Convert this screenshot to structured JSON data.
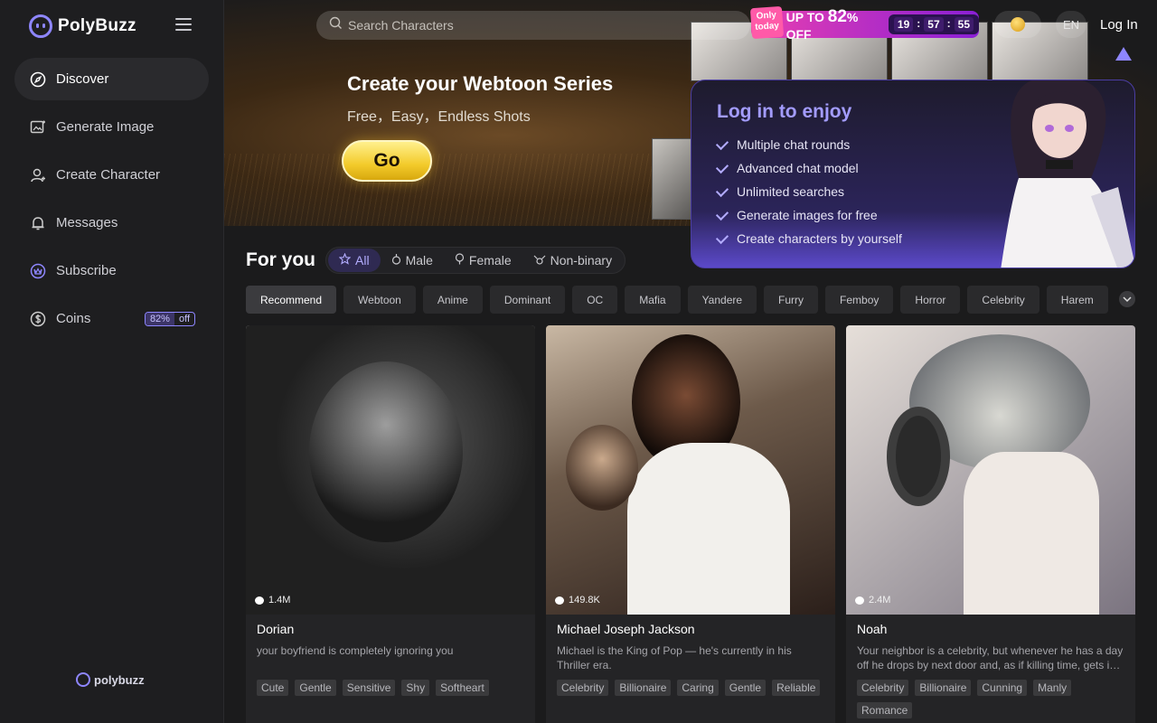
{
  "brand": {
    "name": "PolyBuzz",
    "footer_name": "polybuzz"
  },
  "sidebar": {
    "items": [
      {
        "label": "Discover",
        "icon": "compass-icon",
        "active": true
      },
      {
        "label": "Generate Image",
        "icon": "image-plus-icon"
      },
      {
        "label": "Create Character",
        "icon": "user-plus-icon"
      },
      {
        "label": "Messages",
        "icon": "bell-icon"
      },
      {
        "label": "Subscribe",
        "icon": "crown-icon"
      },
      {
        "label": "Coins",
        "icon": "dollar-icon",
        "badge_percent": "82%",
        "badge_off": "off"
      }
    ]
  },
  "header": {
    "search_placeholder": "Search Characters",
    "promo": {
      "tag_line1": "Only",
      "tag_line2": "today",
      "prefix": "UP TO",
      "percent": "82",
      "percent_sign": "%",
      "suffix": "OFF",
      "hours": "19",
      "minutes": "57",
      "seconds": "55"
    },
    "lang": "EN",
    "login": "Log In"
  },
  "hero": {
    "title": "Create your Webtoon Series",
    "subtitle": "Free，Easy，Endless Shots",
    "cta": "Go"
  },
  "login_card": {
    "title": "Log in to enjoy",
    "perks": [
      "Multiple chat rounds",
      "Advanced chat model",
      "Unlimited searches",
      "Generate images for free",
      "Create characters by yourself"
    ]
  },
  "for_you": {
    "title": "For you",
    "gender_tabs": [
      "All",
      "Male",
      "Female",
      "Non-binary"
    ],
    "categories": [
      "Recommend",
      "Webtoon",
      "Anime",
      "Dominant",
      "OC",
      "Mafia",
      "Yandere",
      "Furry",
      "Femboy",
      "Horror",
      "Celebrity",
      "Harem"
    ]
  },
  "cards": [
    {
      "name": "Dorian",
      "stat": "1.4M",
      "desc": "your boyfriend is completely ignoring you",
      "tags": [
        "Cute",
        "Gentle",
        "Sensitive",
        "Shy",
        "Softheart"
      ]
    },
    {
      "name": "Michael Joseph Jackson",
      "stat": "149.8K",
      "desc": "Michael is the King of Pop — he's currently in his Thriller era.",
      "tags": [
        "Celebrity",
        "Billionaire",
        "Caring",
        "Gentle",
        "Reliable"
      ]
    },
    {
      "name": "Noah",
      "stat": "2.4M",
      "desc": "Your neighbor is a celebrity, but whenever he has a day off he drops by next door and, as if killing time, gets i…",
      "tags": [
        "Celebrity",
        "Billionaire",
        "Cunning",
        "Manly",
        "Romance"
      ]
    }
  ],
  "colors": {
    "accent": "#8e86ff",
    "promo_gradient_start": "#e83fb0",
    "promo_gradient_end": "#8a1fd6",
    "cta_yellow": "#f3cb2b"
  }
}
